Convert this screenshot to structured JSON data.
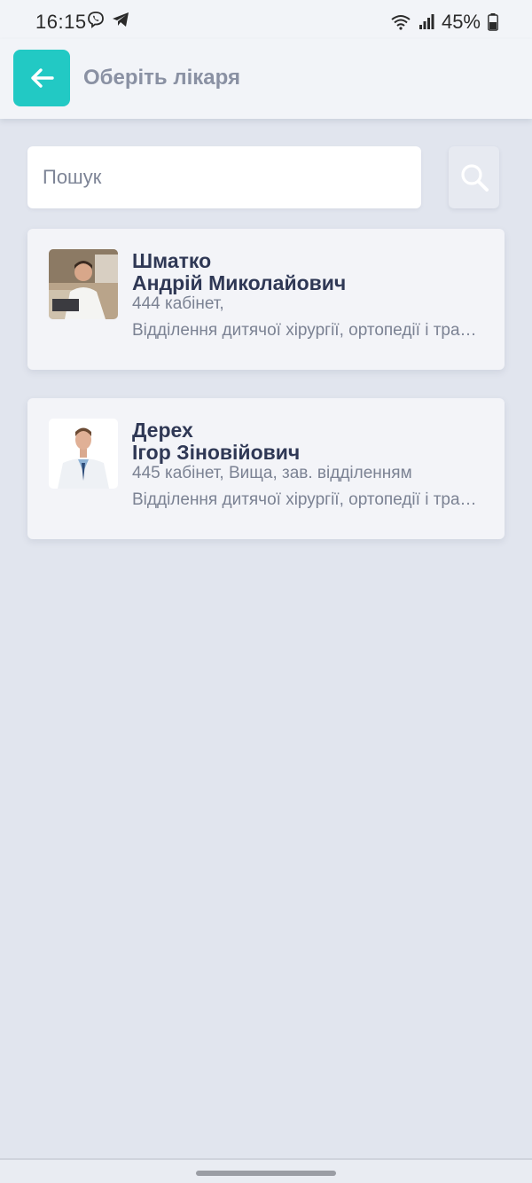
{
  "status_bar": {
    "time": "16:15",
    "battery": "45%",
    "left_icons": [
      "viber-icon",
      "telegram-icon"
    ],
    "right_icons": [
      "wifi-icon",
      "signal-icon",
      "battery-icon"
    ]
  },
  "header": {
    "title": "Оберіть лікаря",
    "back_icon": "arrow-left-icon",
    "accent_color": "#22c9c4"
  },
  "search": {
    "placeholder": "Пошук",
    "button_icon": "search-icon"
  },
  "doctors": [
    {
      "surname": "Шматко",
      "given_names": "Андрій Миколайович",
      "room": "444 кабінет,",
      "department": "Відділення дитячої хірургії, ортопедії і травматології"
    },
    {
      "surname": "Дерех",
      "given_names": "Ігор Зіновійович",
      "room": "445 кабінет, Вища, зав. відділенням",
      "department": "Відділення дитячої хірургії, ортопедії і травматології"
    }
  ],
  "colors": {
    "background": "#e1e5ee",
    "card": "#f3f4f8",
    "name_text": "#2f3855",
    "secondary_text": "#7b8293"
  }
}
